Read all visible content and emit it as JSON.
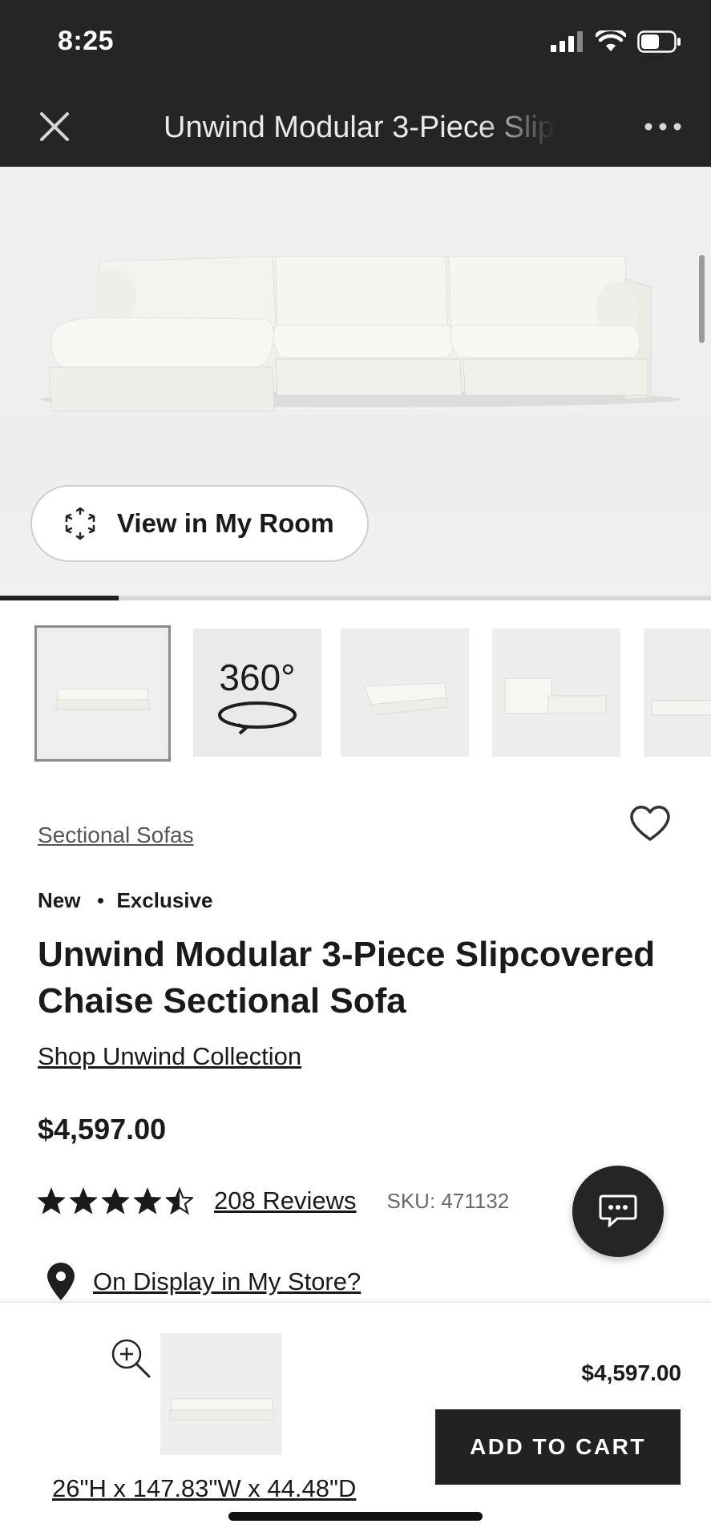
{
  "status_bar": {
    "time": "8:25"
  },
  "header": {
    "title": "Unwind Modular 3-Piece Slipcovered Chaise Sectional Sofa"
  },
  "hero": {
    "view_in_room_label": "View in My Room",
    "gallery_progress_fraction": 0.167
  },
  "thumbnails": {
    "label_360": "360°"
  },
  "product": {
    "category": "Sectional Sofas",
    "badges": [
      "New",
      "Exclusive"
    ],
    "title": "Unwind Modular 3-Piece Slipcovered Chaise Sectional Sofa",
    "collection_link": "Shop Unwind Collection",
    "price": "$4,597.00",
    "rating": 4.5,
    "reviews_label": "208 Reviews",
    "sku_label": "SKU: 471132",
    "display_label": "On Display in My Store?"
  },
  "bottom_bar": {
    "dimensions": "26\"H x 147.83\"W x 44.48\"D",
    "price": "$4,597.00",
    "add_to_cart_label": "ADD TO CART"
  },
  "icons": [
    "close-icon",
    "more-icon",
    "ar-cube-icon",
    "heart-icon",
    "star-icon",
    "half-star-icon",
    "chat-icon",
    "location-pin-icon",
    "zoom-in-icon",
    "rotate-360-icon"
  ],
  "colors": {
    "dark_header": "#252525",
    "text": "#1a1a1a",
    "button": "#222222"
  }
}
